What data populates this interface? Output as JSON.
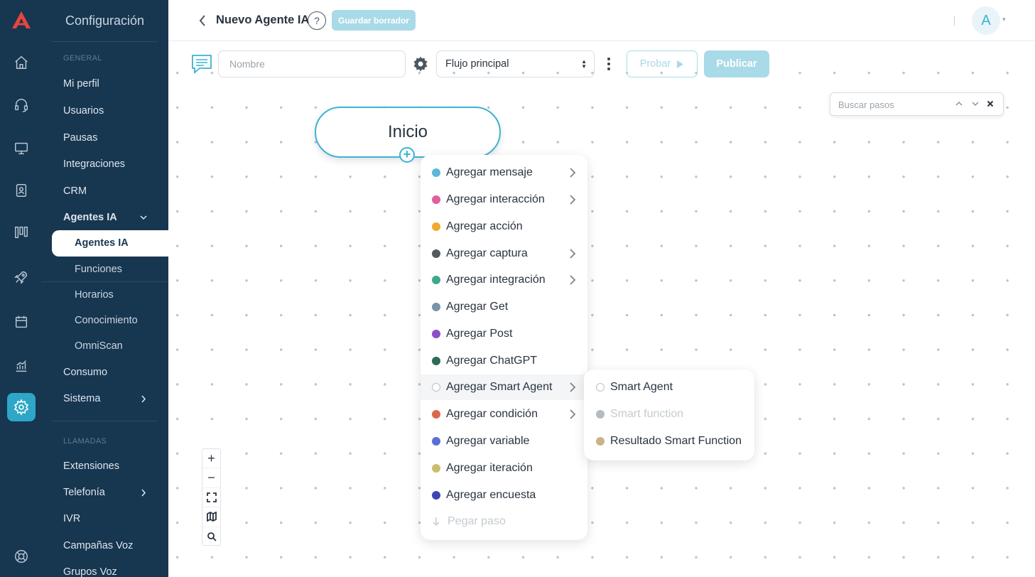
{
  "header": {
    "title": "Nuevo Agente IA",
    "help_icon": "?",
    "save_draft_label": "Guardar borrador",
    "avatar_initial": "A"
  },
  "config_panel": {
    "title": "Configuración",
    "section_general": "GENERAL",
    "items": {
      "profile": "Mi perfil",
      "users": "Usuarios",
      "pauses": "Pausas",
      "integrations": "Integraciones",
      "crm": "CRM",
      "ai_agents": "Agentes IA"
    },
    "ai_agents_sub": {
      "agents": "Agentes IA",
      "functions": "Funciones",
      "schedules": "Horarios",
      "knowledge": "Conocimiento",
      "omniscan": "OmniScan"
    },
    "usage": "Consumo",
    "system": "Sistema",
    "section_calls": "LLAMADAS",
    "calls": {
      "extensions": "Extensiones",
      "telephony": "Telefonía",
      "ivr": "IVR",
      "voice_campaigns": "Campañas Voz",
      "voice_groups": "Grupos Voz"
    }
  },
  "toolbar": {
    "name_placeholder": "Nombre",
    "flow_selected": "Flujo principal",
    "test_label": "Probar",
    "publish_label": "Publicar"
  },
  "search_steps": {
    "placeholder": "Buscar pasos"
  },
  "start_node": {
    "label": "Inicio"
  },
  "add_menu": {
    "items": [
      {
        "label": "Agregar mensaje",
        "color": "#5bb8d6"
      },
      {
        "label": "Agregar interacción",
        "color": "#e0609a"
      },
      {
        "label": "Agregar acción",
        "color": "#f0a92e"
      },
      {
        "label": "Agregar captura",
        "color": "#555a5e"
      },
      {
        "label": "Agregar integración",
        "color": "#3fa88a"
      },
      {
        "label": "Agregar Get",
        "color": "#7a93aa"
      },
      {
        "label": "Agregar Post",
        "color": "#8c4fc9"
      },
      {
        "label": "Agregar ChatGPT",
        "color": "#2f6b57"
      },
      {
        "label": "Agregar Smart Agent",
        "color": "ring"
      },
      {
        "label": "Agregar condición",
        "color": "#d9694e"
      },
      {
        "label": "Agregar variable",
        "color": "#5a6fd6"
      },
      {
        "label": "Agregar iteración",
        "color": "#cbbd6c"
      },
      {
        "label": "Agregar encuesta",
        "color": "#3e45b3"
      }
    ],
    "paste_label": "Pegar paso"
  },
  "smart_submenu": {
    "items": [
      {
        "label": "Smart Agent",
        "color": "ring"
      },
      {
        "label": "Smart function",
        "color": "#b4bbc1"
      },
      {
        "label": "Resultado Smart Function",
        "color": "#c9b485"
      }
    ]
  },
  "colors": {
    "sidebar": "#173650",
    "accent": "#3cb3d3",
    "button_disabled": "#a9dae8"
  }
}
